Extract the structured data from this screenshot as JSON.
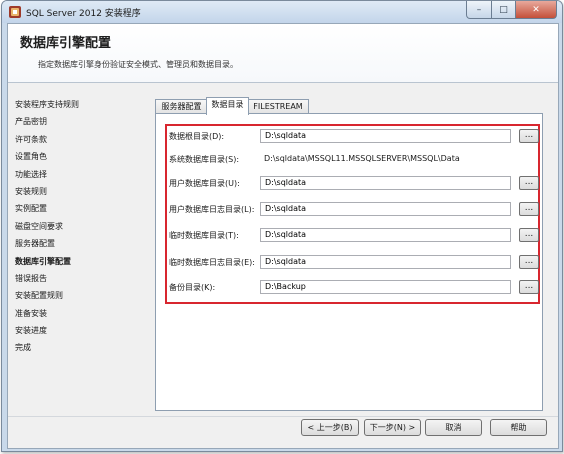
{
  "window": {
    "title": "SQL Server 2012 安装程序",
    "min_label": "–",
    "max_label": "□",
    "close_label": "✕"
  },
  "header": {
    "title": "数据库引擎配置",
    "description": "指定数据库引擎身份验证安全模式、管理员和数据目录。"
  },
  "sidebar": {
    "items": [
      {
        "label": "安装程序支持规则"
      },
      {
        "label": "产品密钥"
      },
      {
        "label": "许可条款"
      },
      {
        "label": "设置角色"
      },
      {
        "label": "功能选择"
      },
      {
        "label": "安装规则"
      },
      {
        "label": "实例配置"
      },
      {
        "label": "磁盘空间要求"
      },
      {
        "label": "服务器配置"
      },
      {
        "label": "数据库引擎配置"
      },
      {
        "label": "错误报告"
      },
      {
        "label": "安装配置规则"
      },
      {
        "label": "准备安装"
      },
      {
        "label": "安装进度"
      },
      {
        "label": "完成"
      }
    ]
  },
  "tabs": [
    {
      "label": "服务器配置"
    },
    {
      "label": "数据目录"
    },
    {
      "label": "FILESTREAM"
    }
  ],
  "fields": {
    "data_root": {
      "label": "数据根目录(D):",
      "value": "D:\\sqldata"
    },
    "system_db": {
      "label": "系统数据库目录(S):",
      "value": "D:\\sqldata\\MSSQL11.MSSQLSERVER\\MSSQL\\Data"
    },
    "user_db": {
      "label": "用户数据库目录(U):",
      "value": "D:\\sqldata"
    },
    "user_log": {
      "label": "用户数据库日志目录(L):",
      "value": "D:\\sqldata"
    },
    "temp_db": {
      "label": "临时数据库目录(T):",
      "value": "D:\\sqldata"
    },
    "temp_log": {
      "label": "临时数据库日志目录(E):",
      "value": "D:\\sqldata"
    },
    "backup": {
      "label": "备份目录(K):",
      "value": "D:\\Backup"
    }
  },
  "browse_label": "...",
  "buttons": {
    "back": "< 上一步(B)",
    "next": "下一步(N) >",
    "cancel": "取消",
    "help": "帮助"
  }
}
